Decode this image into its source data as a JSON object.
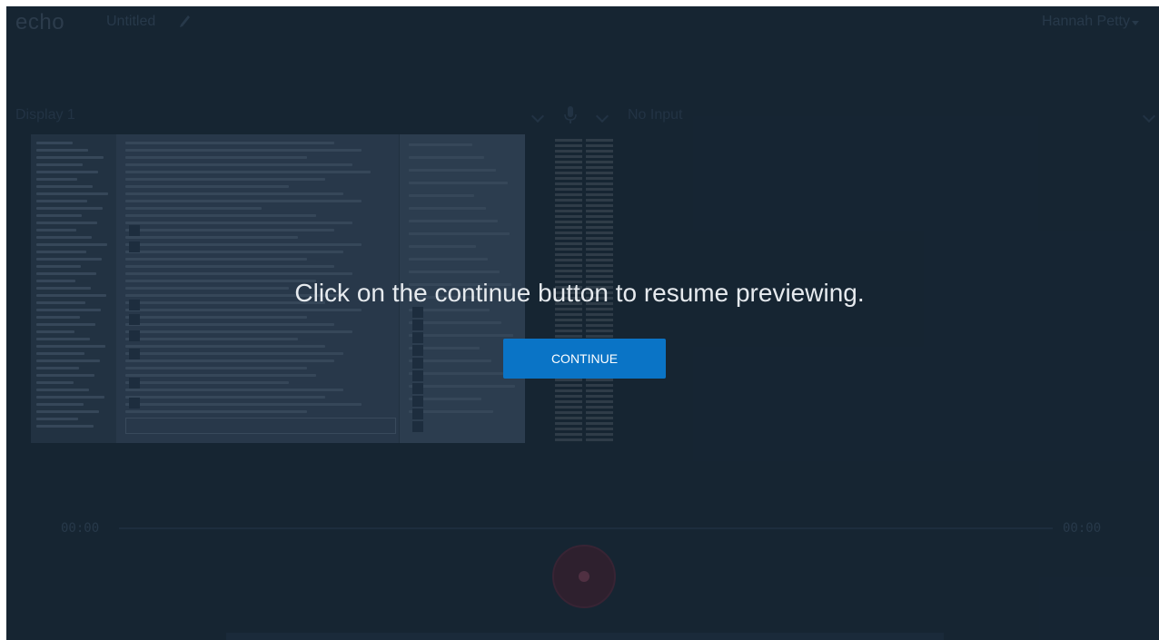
{
  "header": {
    "logo": "echo",
    "title": "Untitled",
    "user_name": "Hannah Petty"
  },
  "sources": {
    "display": "Display 1",
    "audio": "No Input"
  },
  "timeline": {
    "current_time": "00:00",
    "total_time": "00:00"
  },
  "dialog": {
    "message": "Click on the continue button to resume previewing.",
    "button_label": "CONTINUE"
  },
  "icons": {
    "edit_title": "pencil-icon",
    "mic": "microphone-icon",
    "record": "record-icon"
  },
  "colors": {
    "background": "#1b2b3a",
    "button_primary": "#0a74c6",
    "record": "#3c2434"
  }
}
